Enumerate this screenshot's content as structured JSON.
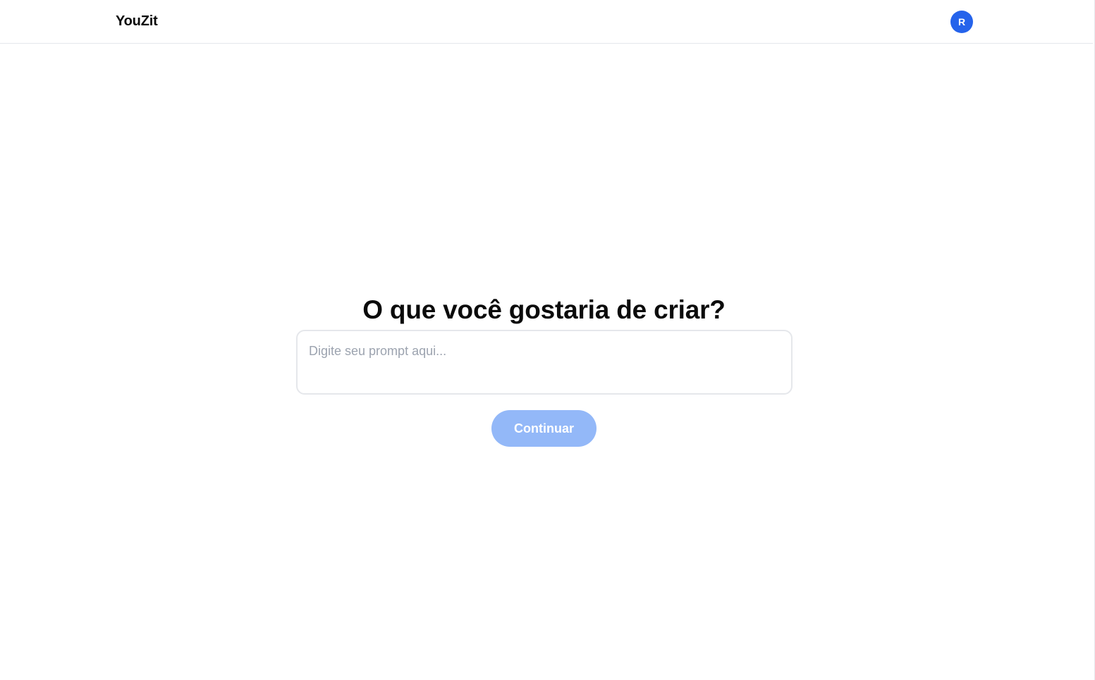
{
  "header": {
    "brand": "YouZit",
    "avatar_initial": "R"
  },
  "main": {
    "title": "O que você gostaria de criar?",
    "prompt": {
      "value": "",
      "placeholder": "Digite seu prompt aqui..."
    },
    "continue_label": "Continuar"
  },
  "colors": {
    "accent": "#2563eb",
    "button_disabled": "#93b8f8",
    "border": "#e5e7eb",
    "placeholder": "#9ca3af"
  }
}
